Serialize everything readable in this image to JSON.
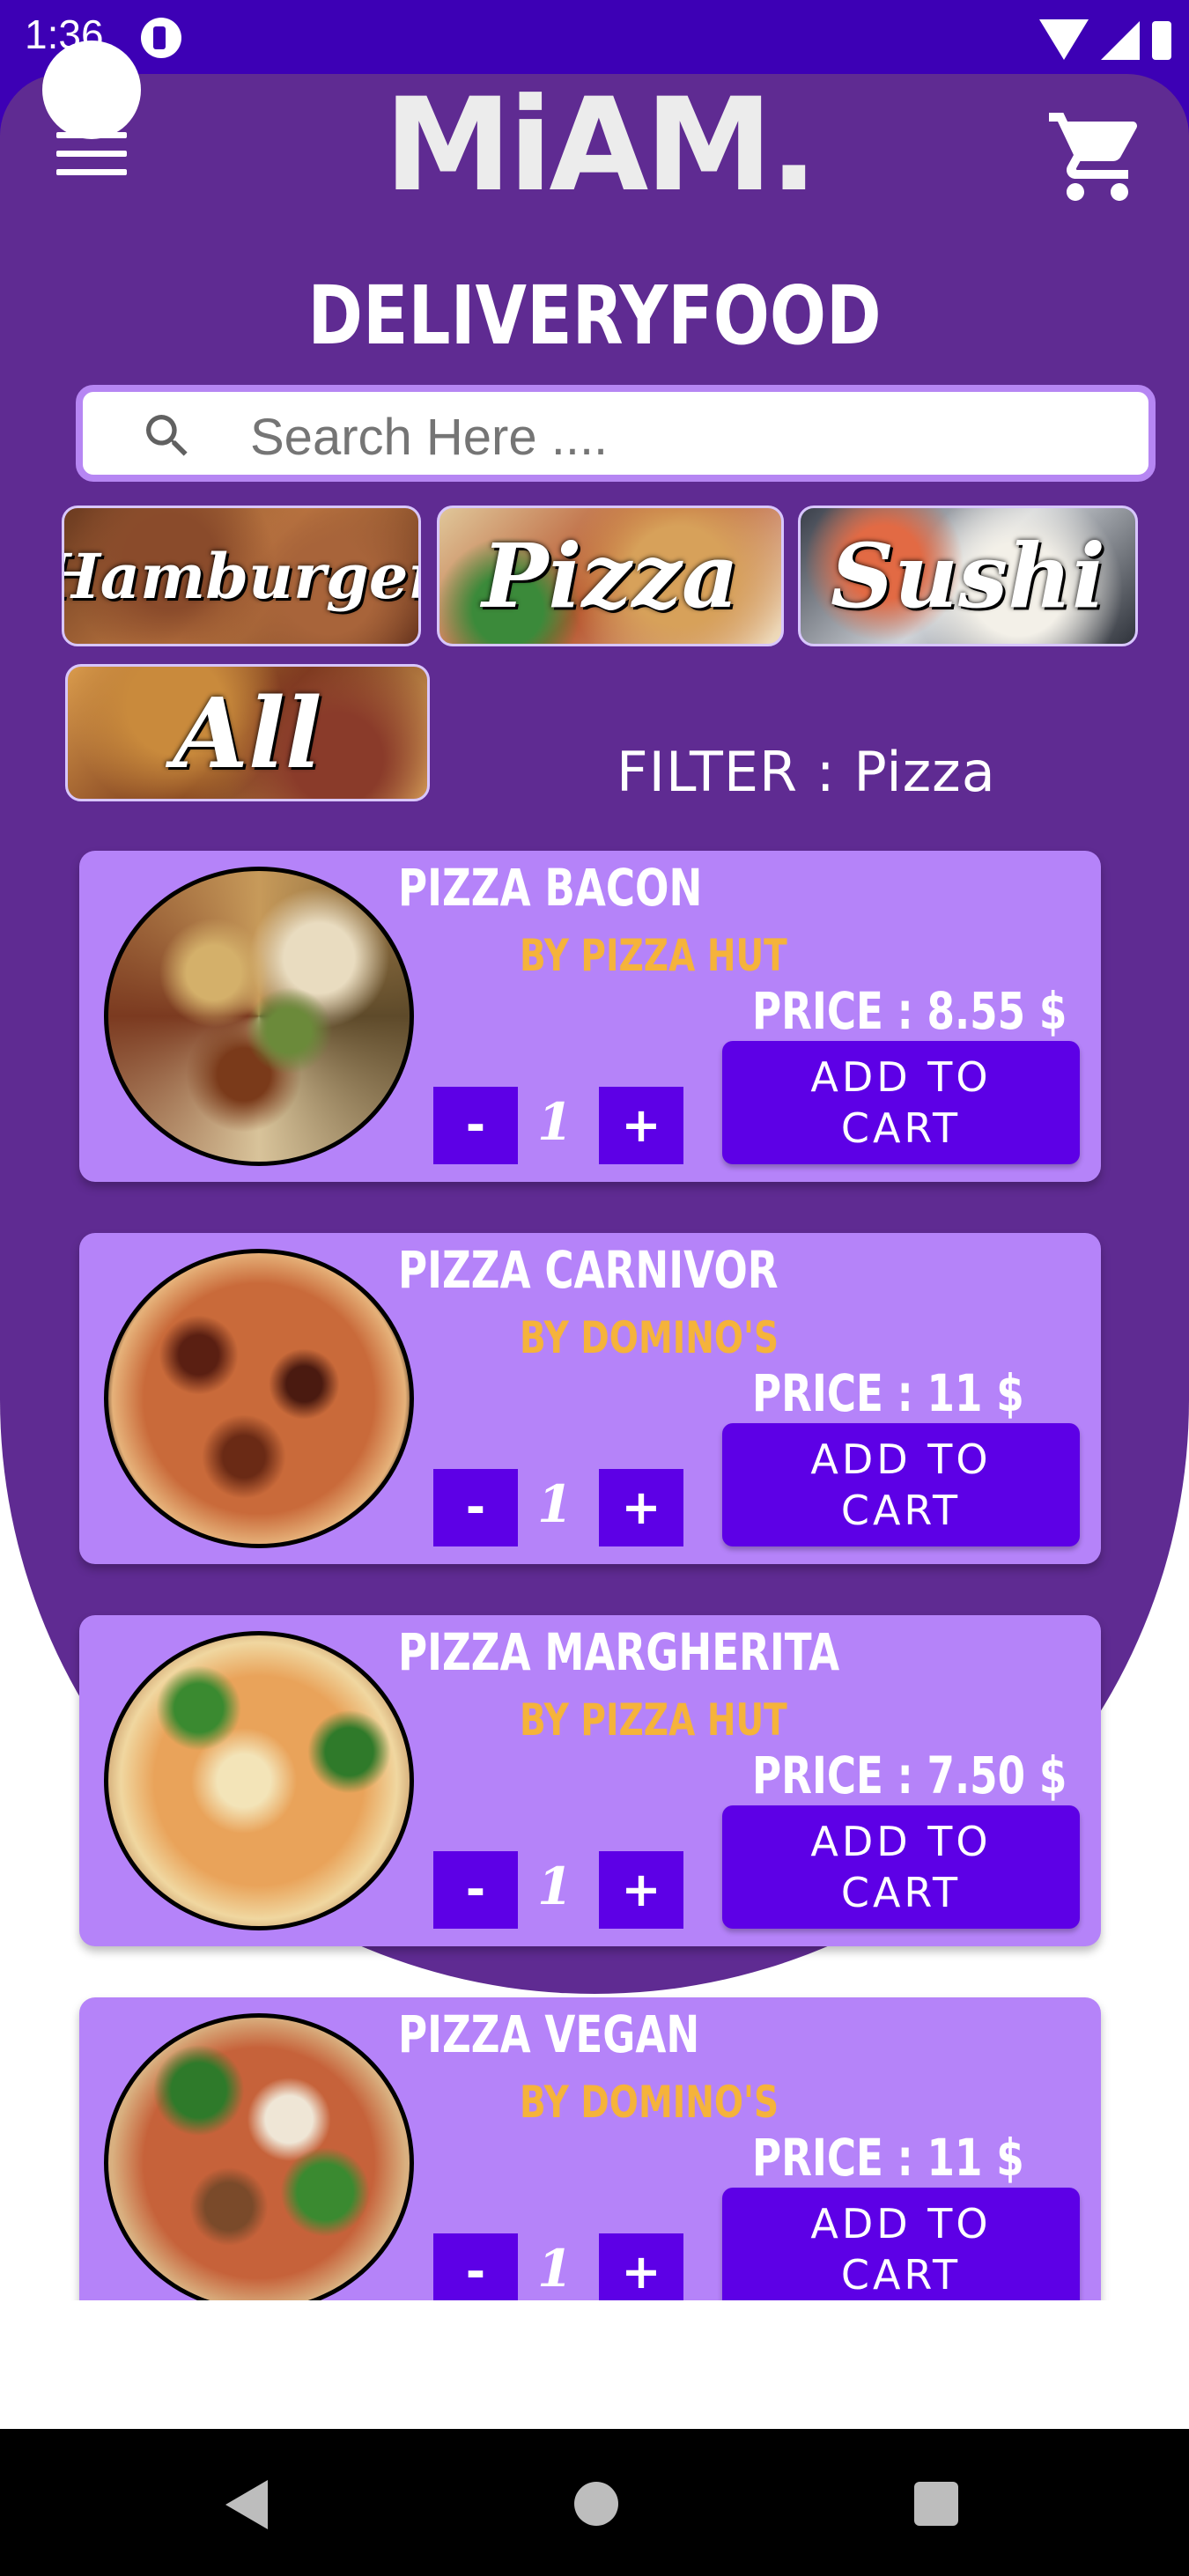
{
  "status_bar": {
    "time": "1:36"
  },
  "header": {
    "logo": "MiAM.",
    "title": "DELIVERYFOOD"
  },
  "search": {
    "placeholder": "Search Here ...."
  },
  "categories": [
    {
      "label": "Hamburger"
    },
    {
      "label": "Pizza"
    },
    {
      "label": "Sushi"
    },
    {
      "label": "All"
    }
  ],
  "filter": {
    "text": "FILTER : Pizza"
  },
  "products": [
    {
      "name": "PIZZA BACON",
      "vendor": "BY PIZZA HUT",
      "price": "PRICE :  8.55 $",
      "quantity": "1",
      "minus": "-",
      "plus": "+",
      "add_label": "ADD TO CART"
    },
    {
      "name": "PIZZA CARNIVOR",
      "vendor": "BY DOMINO'S",
      "price": "PRICE :  11 $",
      "quantity": "1",
      "minus": "-",
      "plus": "+",
      "add_label": "ADD TO CART"
    },
    {
      "name": "PIZZA MARGHERITA",
      "vendor": "BY PIZZA HUT",
      "price": "PRICE :  7.50 $",
      "quantity": "1",
      "minus": "-",
      "plus": "+",
      "add_label": "ADD TO CART"
    },
    {
      "name": "PIZZA VEGAN",
      "vendor": "BY DOMINO'S",
      "price": "PRICE :  11 $",
      "quantity": "1",
      "minus": "-",
      "plus": "+",
      "add_label": "ADD TO CART"
    }
  ],
  "colors": {
    "primary": "#5f2b92",
    "accent": "#5d00e6",
    "card": "#b583f9",
    "vendor": "#f5b33b"
  },
  "icons": [
    "menu-icon",
    "cart-icon",
    "search-icon",
    "back-icon",
    "home-icon",
    "recents-icon"
  ]
}
